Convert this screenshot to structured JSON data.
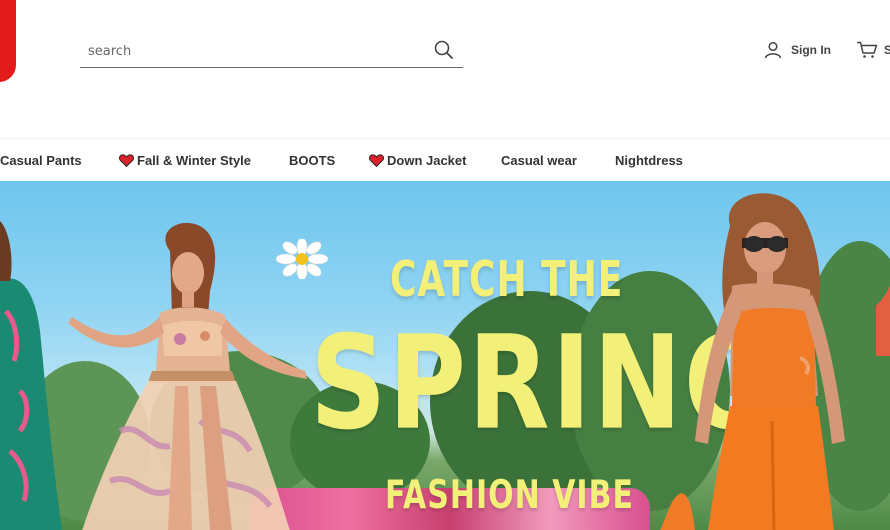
{
  "header": {
    "search": {
      "placeholder": "search",
      "value": ""
    },
    "account": {
      "label": "Sign In",
      "icon": "user-icon"
    },
    "cart": {
      "label": "S",
      "icon": "cart-icon"
    }
  },
  "nav": {
    "items": [
      {
        "label": "Casual Pants",
        "icon": ""
      },
      {
        "label": "Fall & Winter Style",
        "icon": "heart-icon"
      },
      {
        "label": "BOOTS",
        "icon": ""
      },
      {
        "label": "Down Jacket",
        "icon": "heart-icon"
      },
      {
        "label": "Casual wear",
        "icon": ""
      },
      {
        "label": "Nightdress",
        "icon": ""
      }
    ]
  },
  "banner": {
    "line1": "CATCH THE",
    "line2": "SPRING",
    "line3": "FASHION VIBE",
    "text_color": "#f3f07a",
    "brand_color": "#e41b1b"
  }
}
